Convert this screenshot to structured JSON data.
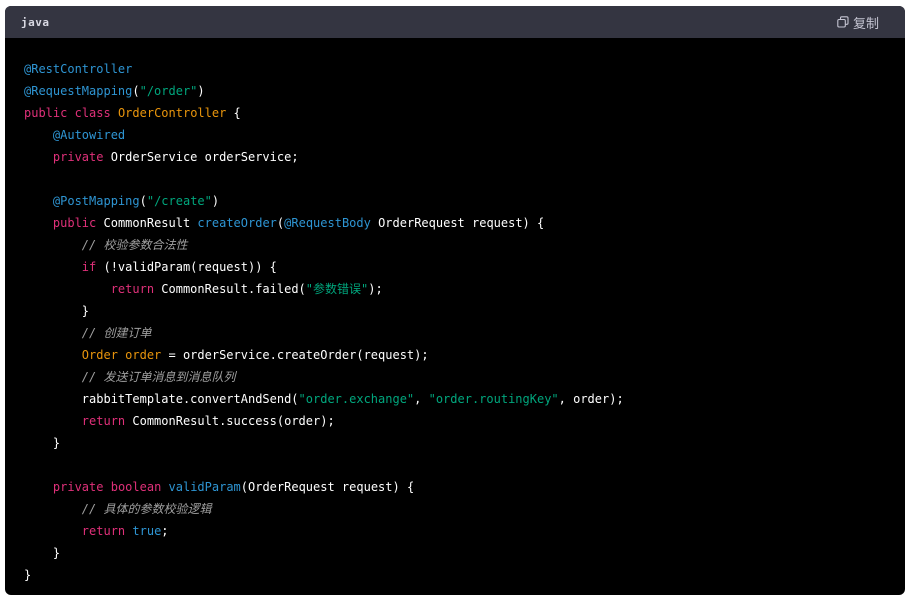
{
  "header": {
    "language": "java",
    "copy_label": "复制",
    "copy_icon": "copy-icon"
  },
  "code": [
    [
      {
        "t": "@RestController",
        "c": "ann"
      }
    ],
    [
      {
        "t": "@RequestMapping",
        "c": "ann"
      },
      {
        "t": "(",
        "c": "pl"
      },
      {
        "t": "\"/order\"",
        "c": "str"
      },
      {
        "t": ")",
        "c": "pl"
      }
    ],
    [
      {
        "t": "public",
        "c": "kw2"
      },
      {
        "t": " ",
        "c": "pl"
      },
      {
        "t": "class",
        "c": "kw2"
      },
      {
        "t": " ",
        "c": "pl"
      },
      {
        "t": "OrderController",
        "c": "var"
      },
      {
        "t": " {",
        "c": "pl"
      }
    ],
    [
      {
        "t": "    ",
        "c": "pl"
      },
      {
        "t": "@Autowired",
        "c": "ann"
      }
    ],
    [
      {
        "t": "    ",
        "c": "pl"
      },
      {
        "t": "private",
        "c": "kw2"
      },
      {
        "t": " OrderService orderService;",
        "c": "pl"
      }
    ],
    [],
    [
      {
        "t": "    ",
        "c": "pl"
      },
      {
        "t": "@PostMapping",
        "c": "ann"
      },
      {
        "t": "(",
        "c": "pl"
      },
      {
        "t": "\"/create\"",
        "c": "str"
      },
      {
        "t": ")",
        "c": "pl"
      }
    ],
    [
      {
        "t": "    ",
        "c": "pl"
      },
      {
        "t": "public",
        "c": "kw2"
      },
      {
        "t": " CommonResult ",
        "c": "pl"
      },
      {
        "t": "createOrder",
        "c": "fn"
      },
      {
        "t": "(",
        "c": "pl"
      },
      {
        "t": "@RequestBody",
        "c": "ann"
      },
      {
        "t": " OrderRequest request) {",
        "c": "pl"
      }
    ],
    [
      {
        "t": "        ",
        "c": "pl"
      },
      {
        "t": "// 校验参数合法性",
        "c": "cm"
      }
    ],
    [
      {
        "t": "        ",
        "c": "pl"
      },
      {
        "t": "if",
        "c": "kw2"
      },
      {
        "t": " (!validParam(request)) {",
        "c": "pl"
      }
    ],
    [
      {
        "t": "            ",
        "c": "pl"
      },
      {
        "t": "return",
        "c": "kw2"
      },
      {
        "t": " CommonResult.failed(",
        "c": "pl"
      },
      {
        "t": "\"参数错误\"",
        "c": "str"
      },
      {
        "t": ");",
        "c": "pl"
      }
    ],
    [
      {
        "t": "        }",
        "c": "pl"
      }
    ],
    [
      {
        "t": "        ",
        "c": "pl"
      },
      {
        "t": "// 创建订单",
        "c": "cm"
      }
    ],
    [
      {
        "t": "        ",
        "c": "pl"
      },
      {
        "t": "Order",
        "c": "var"
      },
      {
        "t": " ",
        "c": "pl"
      },
      {
        "t": "order",
        "c": "var"
      },
      {
        "t": " = orderService.createOrder(request);",
        "c": "pl"
      }
    ],
    [
      {
        "t": "        ",
        "c": "pl"
      },
      {
        "t": "// 发送订单消息到消息队列",
        "c": "cm"
      }
    ],
    [
      {
        "t": "        rabbitTemplate.convertAndSend(",
        "c": "pl"
      },
      {
        "t": "\"order.exchange\"",
        "c": "str"
      },
      {
        "t": ", ",
        "c": "pl"
      },
      {
        "t": "\"order.routingKey\"",
        "c": "str"
      },
      {
        "t": ", order);",
        "c": "pl"
      }
    ],
    [
      {
        "t": "        ",
        "c": "pl"
      },
      {
        "t": "return",
        "c": "kw2"
      },
      {
        "t": " CommonResult.success(order);",
        "c": "pl"
      }
    ],
    [
      {
        "t": "    }",
        "c": "pl"
      }
    ],
    [],
    [
      {
        "t": "    ",
        "c": "pl"
      },
      {
        "t": "private",
        "c": "kw2"
      },
      {
        "t": " ",
        "c": "pl"
      },
      {
        "t": "boolean",
        "c": "kw2"
      },
      {
        "t": " ",
        "c": "pl"
      },
      {
        "t": "validParam",
        "c": "fn"
      },
      {
        "t": "(OrderRequest request) {",
        "c": "pl"
      }
    ],
    [
      {
        "t": "        ",
        "c": "pl"
      },
      {
        "t": "// 具体的参数校验逻辑",
        "c": "cm"
      }
    ],
    [
      {
        "t": "        ",
        "c": "pl"
      },
      {
        "t": "return",
        "c": "kw2"
      },
      {
        "t": " ",
        "c": "pl"
      },
      {
        "t": "true",
        "c": "kw"
      },
      {
        "t": ";",
        "c": "pl"
      }
    ],
    [
      {
        "t": "    }",
        "c": "pl"
      }
    ],
    [
      {
        "t": "}",
        "c": "pl"
      }
    ]
  ]
}
